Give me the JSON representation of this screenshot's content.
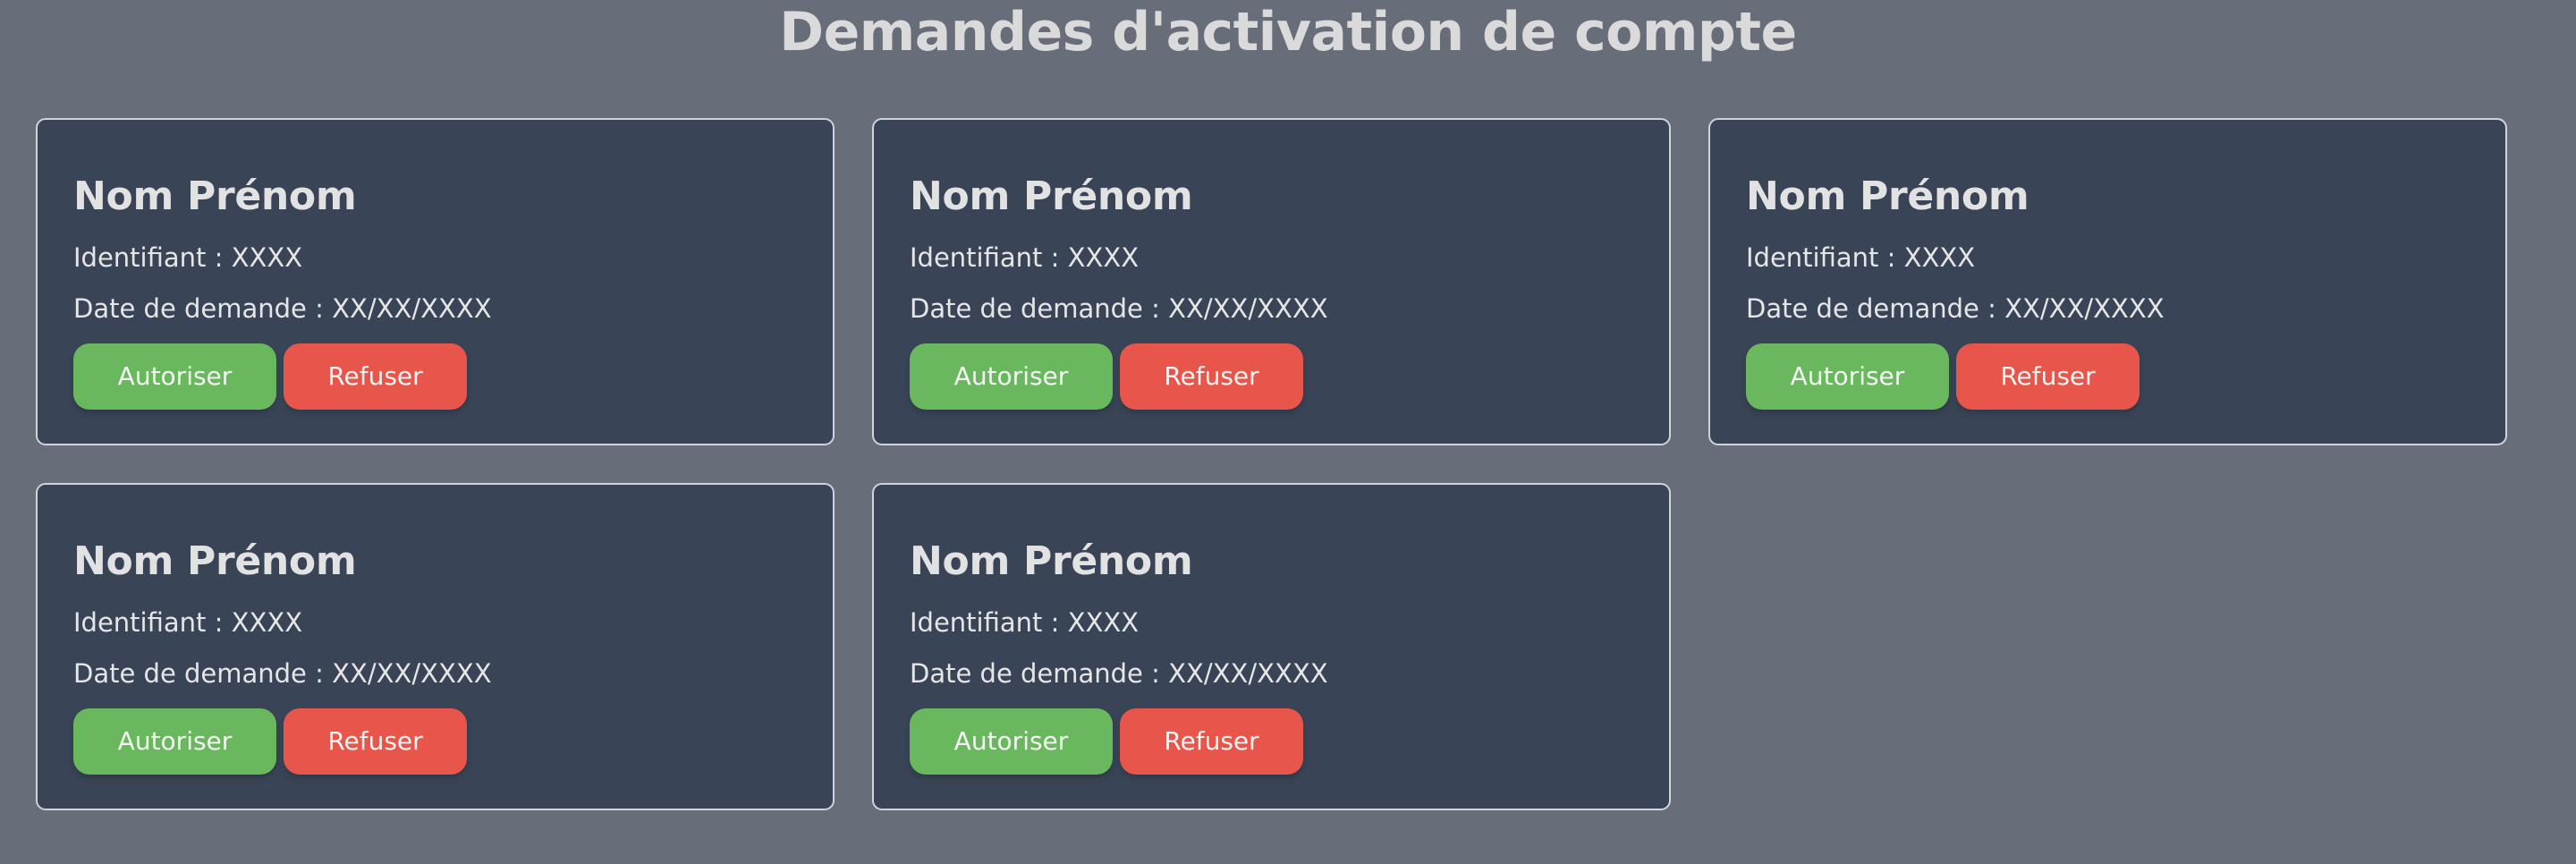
{
  "page": {
    "title": "Demandes d'activation de compte"
  },
  "labels": {
    "id_label": "Identifiant :",
    "date_label": "Date de demande :",
    "approve": "Autoriser",
    "refuse": "Refuser"
  },
  "colors": {
    "background": "#676d79",
    "card": "#394556",
    "approve": "#6ab85d",
    "refuse": "#e8554a"
  },
  "requests": [
    {
      "name": "Nom Prénom",
      "id": "XXXX",
      "date": "XX/XX/XXXX"
    },
    {
      "name": "Nom Prénom",
      "id": "XXXX",
      "date": "XX/XX/XXXX"
    },
    {
      "name": "Nom Prénom",
      "id": "XXXX",
      "date": "XX/XX/XXXX"
    },
    {
      "name": "Nom Prénom",
      "id": "XXXX",
      "date": "XX/XX/XXXX"
    },
    {
      "name": "Nom Prénom",
      "id": "XXXX",
      "date": "XX/XX/XXXX"
    }
  ]
}
